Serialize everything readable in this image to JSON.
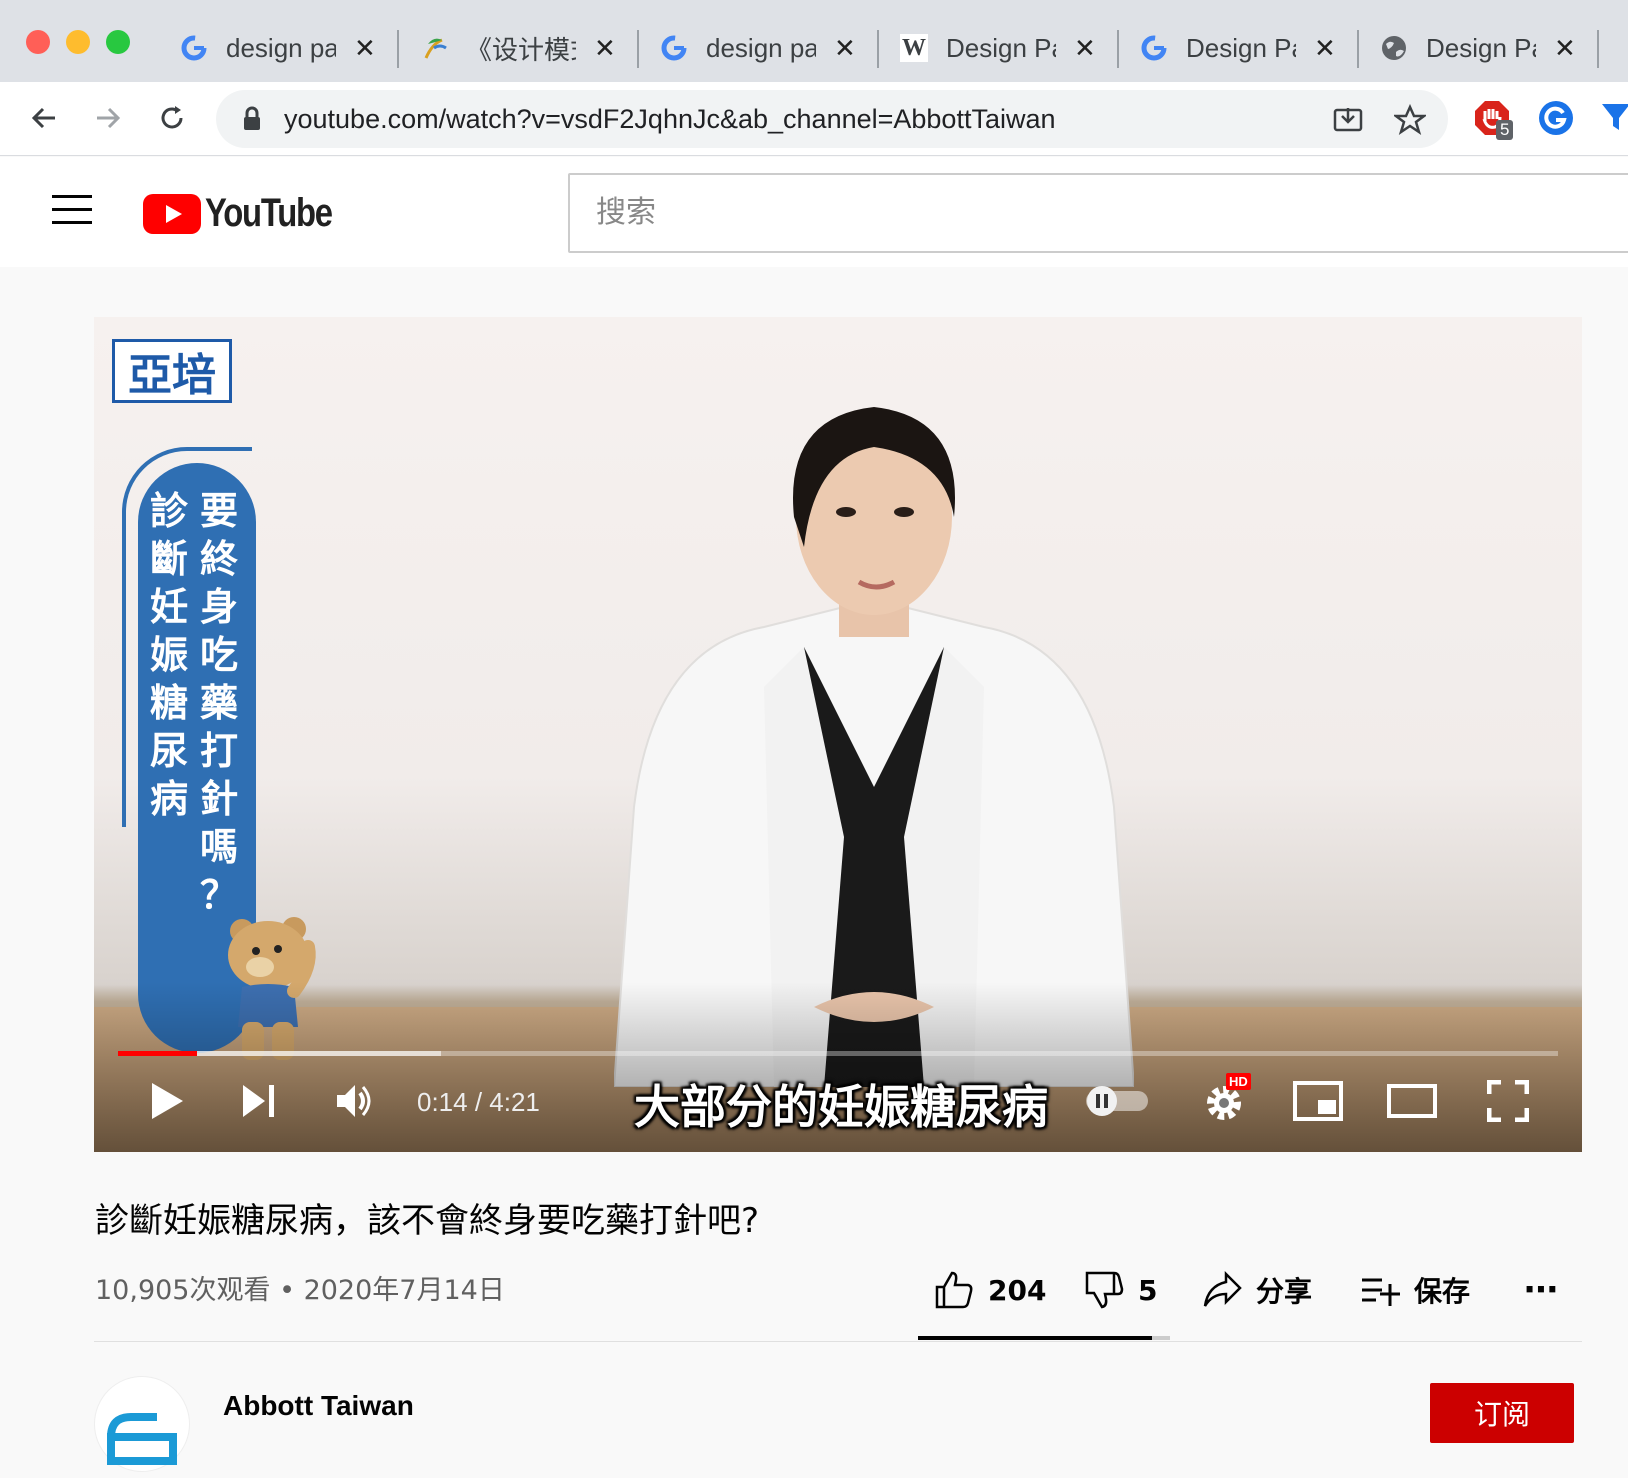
{
  "browser": {
    "tabs": [
      {
        "title": "design pa",
        "favicon": "google-icon",
        "close": "✕"
      },
      {
        "title": "《设计模式",
        "favicon": "palm-icon",
        "close": "✕"
      },
      {
        "title": "design pa",
        "favicon": "google-icon",
        "close": "✕"
      },
      {
        "title": "Design Pa",
        "favicon": "wikipedia-icon",
        "favicon_text": "W",
        "close": "✕"
      },
      {
        "title": "Design Pa",
        "favicon": "google-icon",
        "close": "✕"
      },
      {
        "title": "Design Pa",
        "favicon": "globe-icon",
        "close": "✕"
      }
    ],
    "url": "youtube.com/watch?v=vsdF2JqhnJc&ab_channel=AbbottTaiwan",
    "extension_badge": "5"
  },
  "youtube": {
    "logo_text": "YouTube",
    "search_placeholder": "搜索"
  },
  "player": {
    "logo_text": "亞培",
    "banner_col_right": [
      "要",
      "終",
      "身",
      "吃",
      "藥",
      "打",
      "針",
      "嗎",
      "？"
    ],
    "banner_col_left": [
      "診",
      "斷",
      "妊",
      "娠",
      "糖",
      "尿",
      "病"
    ],
    "subtitle": "大部分的妊娠糖尿病",
    "time_current": "0:14",
    "time_separator": " / ",
    "time_total": "4:21",
    "progress_played_fraction": 0.055,
    "progress_buffered_fraction": 0.224,
    "hd_badge": "HD"
  },
  "video": {
    "title": "診斷妊娠糖尿病，該不會終身要吃藥打針吧?",
    "views": "10,905次观看",
    "dot": " • ",
    "date": "2020年7月14日",
    "likes": "204",
    "dislikes": "5",
    "share_label": "分享",
    "save_label": "保存",
    "more_label": "⋯",
    "like_ratio": 0.93
  },
  "channel": {
    "name": "Abbott Taiwan",
    "subscribe_label": "订阅"
  },
  "colors": {
    "youtube_red": "#ff0000",
    "subscribe_red": "#cc0000",
    "abbott_blue": "#2f6fb3"
  }
}
